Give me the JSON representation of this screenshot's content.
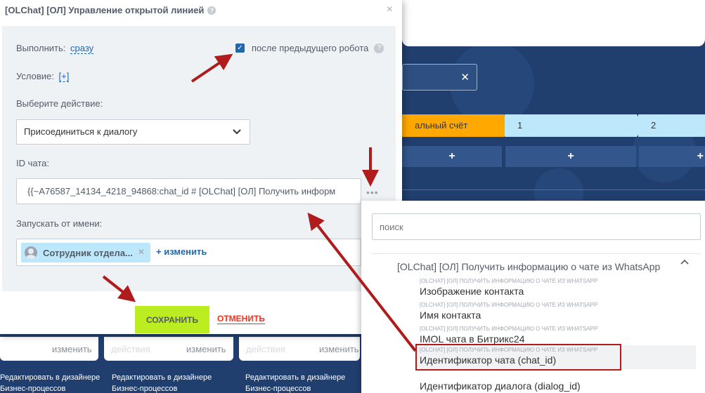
{
  "background": {
    "stages": [
      "альный счёт",
      "1",
      "2"
    ],
    "add_symbol": "+",
    "search_clear": "✕",
    "cards": [
      {
        "ghost": "",
        "action": "изменить",
        "edit_text": "Редактировать в дизайнере Бизнес-процессов"
      },
      {
        "ghost": "действия",
        "action": "изменить",
        "edit_text": "Редактировать в дизайнере Бизнес-процессов"
      },
      {
        "ghost": "действия",
        "action": "изменить",
        "edit_text": "Бизнес-процессов"
      }
    ]
  },
  "dialog": {
    "title": "[OLChat] [ОЛ] Управление открытой линией",
    "help_symbol": "?",
    "close_symbol": "×",
    "execute_label": "Выполнить:",
    "execute_value": "сразу",
    "after_prev_checked": true,
    "after_prev_label": "после предыдущего робота",
    "condition_label": "Условие:",
    "condition_value": "[+]",
    "action_label": "Выберите действие:",
    "action_value": "Присоединиться к диалогу",
    "chat_id_label": "ID чата:",
    "chat_id_value": "{{~A76587_14134_4218_94868:chat_id # [OLChat] [ОЛ] Получить информ",
    "dots": "•••",
    "run_as_label": "Запускать от имени:",
    "run_as_user": "Сотрудник отдела...",
    "run_as_change": "+ изменить",
    "save_label": "СОХРАНИТЬ",
    "cancel_label": "ОТМЕНИТЬ"
  },
  "popup": {
    "search_placeholder": "поиск",
    "group_title": "[OLChat] [ОЛ] Получить информацию о чате из WhatsApp",
    "items": [
      {
        "caption": "[OLCHAT] [ОЛ] ПОЛУЧИТЬ ИНФОРМАЦИЮ О ЧАТЕ ИЗ WHATSAPP",
        "value": "Изображение контакта"
      },
      {
        "caption": "[OLCHAT] [ОЛ] ПОЛУЧИТЬ ИНФОРМАЦИЮ О ЧАТЕ ИЗ WHATSAPP",
        "value": "Имя контакта"
      },
      {
        "caption": "[OLCHAT] [ОЛ] ПОЛУЧИТЬ ИНФОРМАЦИЮ О ЧАТЕ ИЗ WHATSAPP",
        "value": "IMOL чата в Битрикс24"
      },
      {
        "caption": "[OLCHAT] [ОЛ] ПОЛУЧИТЬ ИНФОРМАЦИЮ О ЧАТЕ ИЗ WHATSAPP",
        "value": "Идентификатор чата (chat_id)"
      },
      {
        "caption": "",
        "value": "Идентификатор диалога (dialog_id)"
      }
    ]
  },
  "colors": {
    "accent": "#2067b0",
    "save_button": "#bbed21",
    "cancel": "#f2321e",
    "annotation": "#b01c1c",
    "background": "#203f6e"
  }
}
